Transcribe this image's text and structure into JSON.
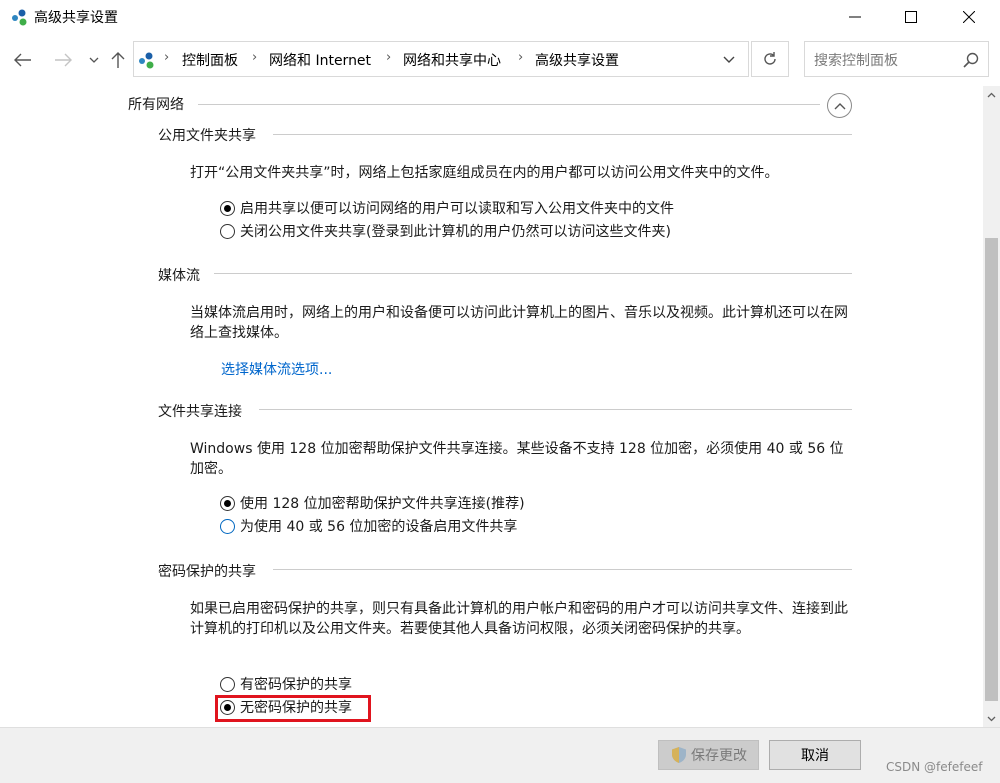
{
  "window": {
    "title": "高级共享设置",
    "buttons": [
      "minimize",
      "maximize",
      "close"
    ]
  },
  "nav": {
    "breadcrumb": [
      "控制面板",
      "网络和 Internet",
      "网络和共享中心",
      "高级共享设置"
    ],
    "search_placeholder": "搜索控制面板"
  },
  "content": {
    "group_header": "所有网络",
    "sections": [
      {
        "title": "公用文件夹共享",
        "description": "打开“公用文件夹共享”时，网络上包括家庭组成员在内的用户都可以访问公用文件夹中的文件。",
        "options": [
          {
            "label": "启用共享以便可以访问网络的用户可以读取和写入公用文件夹中的文件",
            "checked": true
          },
          {
            "label": "关闭公用文件夹共享(登录到此计算机的用户仍然可以访问这些文件夹)",
            "checked": false
          }
        ]
      },
      {
        "title": "媒体流",
        "description": "当媒体流启用时，网络上的用户和设备便可以访问此计算机上的图片、音乐以及视频。此计算机还可以在网络上查找媒体。",
        "link": "选择媒体流选项..."
      },
      {
        "title": "文件共享连接",
        "description": "Windows 使用 128 位加密帮助保护文件共享连接。某些设备不支持 128 位加密，必须使用 40 或 56 位加密。",
        "options": [
          {
            "label": "使用 128 位加密帮助保护文件共享连接(推荐)",
            "checked": true
          },
          {
            "label": "为使用 40 或 56 位加密的设备启用文件共享",
            "checked": false
          }
        ]
      },
      {
        "title": "密码保护的共享",
        "description": "如果已启用密码保护的共享，则只有具备此计算机的用户帐户和密码的用户才可以访问共享文件、连接到此计算机的打印机以及公用文件夹。若要使其他人具备访问权限，必须关闭密码保护的共享。",
        "options": [
          {
            "label": "有密码保护的共享",
            "checked": false
          },
          {
            "label": "无密码保护的共享",
            "checked": true
          }
        ]
      }
    ]
  },
  "footer": {
    "save_label": "保存更改",
    "cancel_label": "取消",
    "watermark": "CSDN @fefefeef"
  },
  "colors": {
    "link": "#0066cc",
    "highlight": "#e0141e",
    "footer_bg": "#f0f0f0"
  }
}
